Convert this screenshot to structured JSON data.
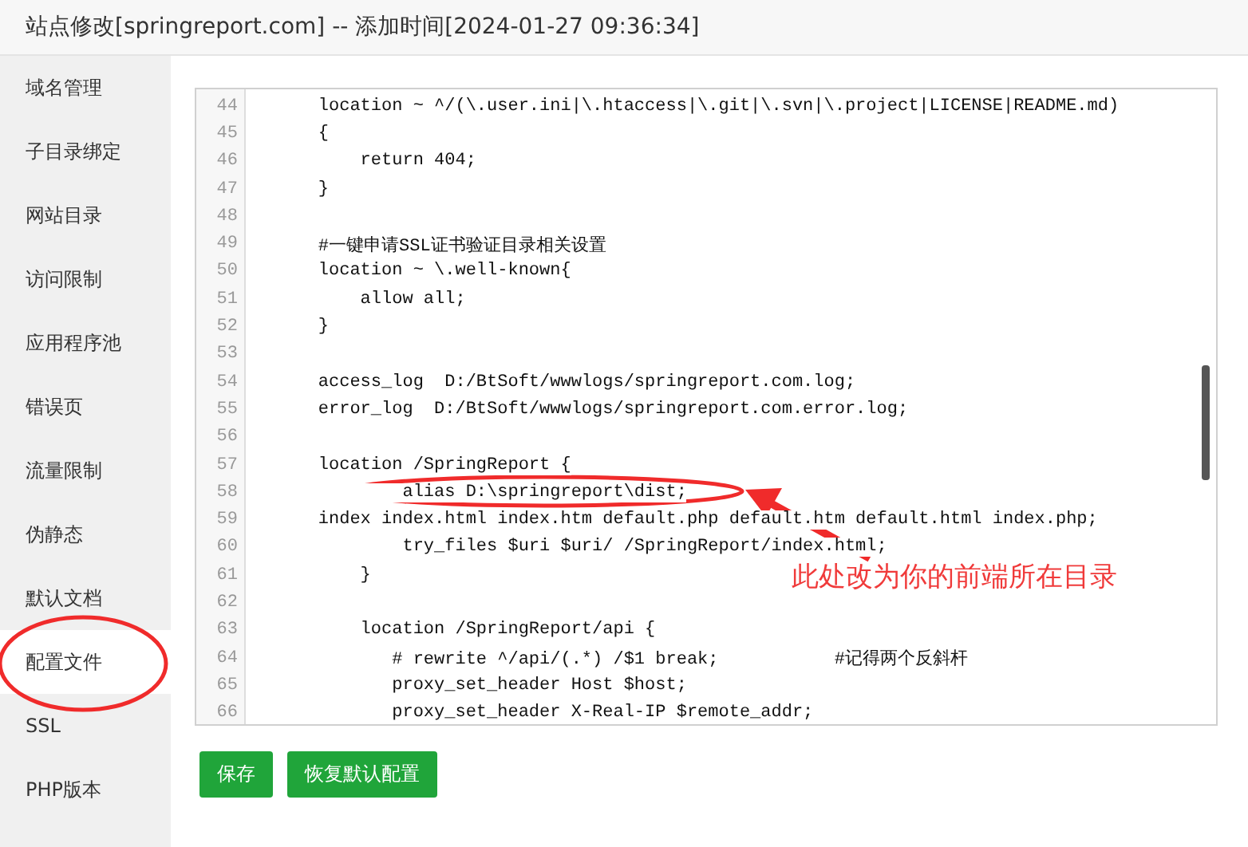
{
  "window": {
    "title": "站点修改[springreport.com] -- 添加时间[2024-01-27 09:36:34]"
  },
  "sidebar": {
    "items": [
      {
        "label": "域名管理",
        "selected": false
      },
      {
        "label": "子目录绑定",
        "selected": false
      },
      {
        "label": "网站目录",
        "selected": false
      },
      {
        "label": "访问限制",
        "selected": false
      },
      {
        "label": "应用程序池",
        "selected": false
      },
      {
        "label": "错误页",
        "selected": false
      },
      {
        "label": "流量限制",
        "selected": false
      },
      {
        "label": "伪静态",
        "selected": false
      },
      {
        "label": "默认文档",
        "selected": false
      },
      {
        "label": "配置文件",
        "selected": true
      },
      {
        "label": "SSL",
        "selected": false
      },
      {
        "label": "PHP版本",
        "selected": false
      }
    ]
  },
  "editor": {
    "lines": [
      {
        "number": "44",
        "text": "    location ~ ^/(\\.user.ini|\\.htaccess|\\.git|\\.svn|\\.project|LICENSE|README.md)"
      },
      {
        "number": "45",
        "text": "    {"
      },
      {
        "number": "46",
        "text": "        return 404;"
      },
      {
        "number": "47",
        "text": "    }"
      },
      {
        "number": "48"
      },
      {
        "number": "49",
        "text": "    #一键申请SSL证书验证目录相关设置"
      },
      {
        "number": "50",
        "text": "    location ~ \\.well-known{"
      },
      {
        "number": "51",
        "text": "        allow all;"
      },
      {
        "number": "52",
        "text": "    }"
      },
      {
        "number": "53"
      },
      {
        "number": "54",
        "text": "    access_log  D:/BtSoft/wwwlogs/springreport.com.log;"
      },
      {
        "number": "55",
        "text": "    error_log  D:/BtSoft/wwwlogs/springreport.com.error.log;"
      },
      {
        "number": "56"
      },
      {
        "number": "57",
        "text": "    location /SpringReport {"
      },
      {
        "number": "58",
        "text": "            alias D:\\springreport\\dist;"
      },
      {
        "number": "59",
        "text": "    index index.html index.htm default.php default.htm default.html index.php;"
      },
      {
        "number": "60",
        "text": "            try_files $uri $uri/ /SpringReport/index.html;"
      },
      {
        "number": "61",
        "text": "        }"
      },
      {
        "number": "62"
      },
      {
        "number": "63",
        "text": "        location /SpringReport/api {"
      },
      {
        "number": "64",
        "text": "           # rewrite ^/api/(.*) /$1 break;           #记得两个反斜杆"
      },
      {
        "number": "65",
        "text": "           proxy_set_header Host $host;"
      },
      {
        "number": "66",
        "text": "           proxy_set_header X-Real-IP $remote_addr;"
      }
    ]
  },
  "buttons": [
    {
      "label": "保存"
    },
    {
      "label": "恢复默认配置"
    }
  ],
  "annotation": {
    "text": "此处改为你的前端所在目录"
  }
}
